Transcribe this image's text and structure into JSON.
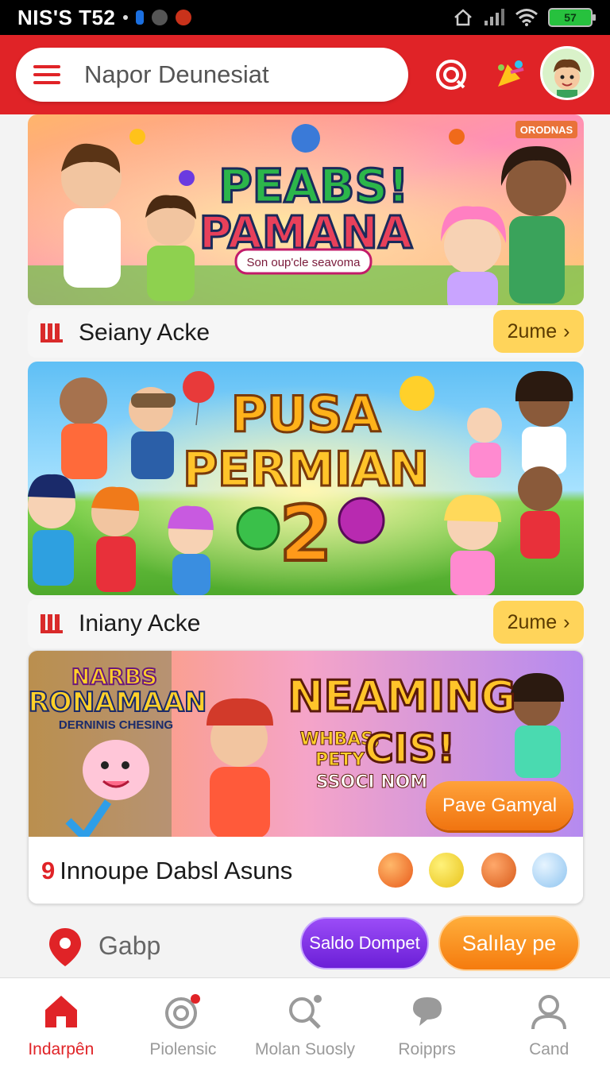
{
  "status_bar": {
    "left_text": "NIS'S T52",
    "battery": "57"
  },
  "search": {
    "placeholder": "Napor Deunesiat"
  },
  "banners": [
    {
      "title_line1": "PEABS!",
      "title_line2": "PAMANA",
      "subtitle": "Son oup'cle seavoma",
      "corner_tag": "ORODNAS"
    },
    {
      "title_line1": "PUSA",
      "title_line2": "PERMIAN",
      "number": "2"
    }
  ],
  "rows": [
    {
      "label": "Seiany Acke",
      "button": "2ume"
    },
    {
      "label": "Iniany Acke",
      "button": "2ume"
    }
  ],
  "card": {
    "left_title1": "NARBS",
    "left_title2": "RONAMAAN",
    "left_sub": "DERNINIS CHESING",
    "headline": "NEAMING",
    "sub1": "WHBAS,",
    "sub2": "PETY",
    "sub3": "CIS!",
    "sub4": "SSOCI NOM",
    "cta": "Pave Gamyal",
    "footer_num": "9",
    "footer_text": "Innoupe Dabsl Asuns"
  },
  "actions": {
    "location": "Gabp",
    "wallet_button": "Saldo Dompet",
    "orange_button": "Salılay pe"
  },
  "nav": [
    {
      "label": "Indarpên",
      "icon": "home-icon",
      "active": true
    },
    {
      "label": "Piolensic",
      "icon": "target-icon",
      "active": false
    },
    {
      "label": "Molan Suosly",
      "icon": "search-icon",
      "active": false
    },
    {
      "label": "Roipprs",
      "icon": "chat-icon",
      "active": false
    },
    {
      "label": "Cand",
      "icon": "profile-icon",
      "active": false
    }
  ],
  "colors": {
    "brand": "#e02327",
    "accent": "#ffd45a",
    "wallet": "#7a2be8",
    "cta": "#f57b0e"
  }
}
